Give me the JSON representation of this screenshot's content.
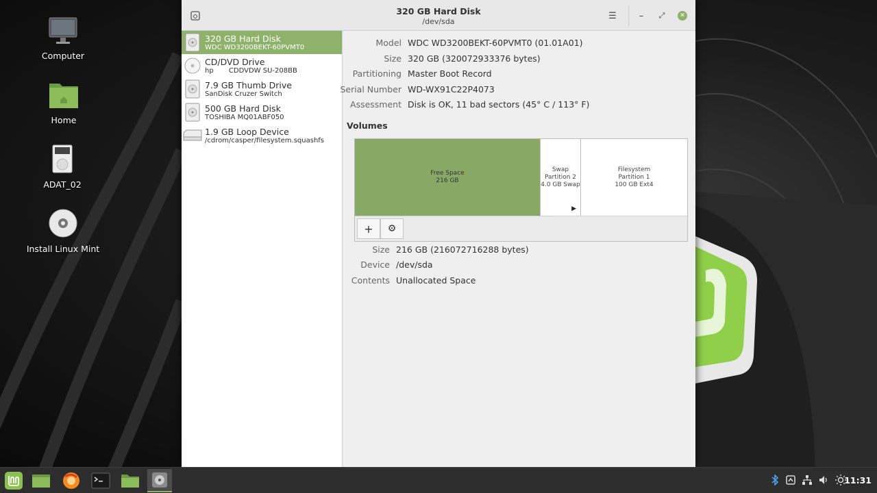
{
  "desktop": {
    "icons": [
      {
        "label": "Computer",
        "icon": "monitor-icon"
      },
      {
        "label": "Home",
        "icon": "folder-home-icon"
      },
      {
        "label": "ADAT_02",
        "icon": "drive-icon"
      },
      {
        "label": "Install Linux Mint",
        "icon": "disc-icon"
      }
    ]
  },
  "window": {
    "title": "320 GB Hard Disk",
    "subtitle": "/dev/sda",
    "buttons": {
      "menu": "☰",
      "minimize": "–",
      "maximize": "⤢",
      "close": "✕"
    }
  },
  "devices": [
    {
      "name": "320 GB Hard Disk",
      "sub": "WDC WD3200BEKT-60PVMT0",
      "selected": true,
      "icon": "hard-disk-icon"
    },
    {
      "name": "CD/DVD Drive",
      "sub": "hp       CDDVDW SU-208BB",
      "selected": false,
      "icon": "optical-drive-icon"
    },
    {
      "name": "7.9 GB Thumb Drive",
      "sub": "SanDisk Cruzer Switch",
      "selected": false,
      "icon": "usb-drive-icon"
    },
    {
      "name": "500 GB Hard Disk",
      "sub": "TOSHIBA MQ01ABF050",
      "selected": false,
      "icon": "hard-disk-icon"
    },
    {
      "name": "1.9 GB Loop Device",
      "sub": "/cdrom/casper/filesystem.squashfs",
      "selected": false,
      "icon": "loop-device-icon"
    }
  ],
  "drive": {
    "model_label": "Model",
    "model": "WDC WD3200BEKT-60PVMT0 (01.01A01)",
    "size_label": "Size",
    "size": "320 GB (320072933376 bytes)",
    "partitioning_label": "Partitioning",
    "partitioning": "Master Boot Record",
    "serial_label": "Serial Number",
    "serial": "WD-WX91C22P4073",
    "assessment_label": "Assessment",
    "assessment": "Disk is OK, 11 bad sectors (45° C / 113° F)"
  },
  "volumes": {
    "title": "Volumes",
    "segments": [
      {
        "line1": "Free Space",
        "line2": "216 GB",
        "line3": ""
      },
      {
        "line1": "Swap",
        "line2": "Partition 2",
        "line3": "4.0 GB Swap"
      },
      {
        "line1": "Filesystem",
        "line2": "Partition 1",
        "line3": "100 GB Ext4"
      }
    ],
    "add_label": "+",
    "settings_label": "⚙"
  },
  "selected_volume": {
    "size_label": "Size",
    "size": "216 GB (216072716288 bytes)",
    "device_label": "Device",
    "device": "/dev/sda",
    "contents_label": "Contents",
    "contents": "Unallocated Space"
  },
  "taskbar": {
    "clock": "11:31",
    "colors": {
      "accent": "#8fb26a",
      "panel": "#2d2d2d"
    }
  }
}
